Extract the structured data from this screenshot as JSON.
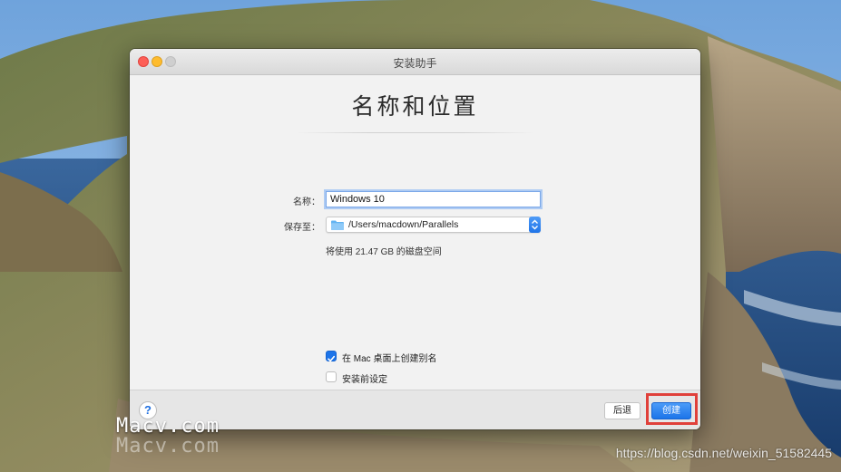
{
  "window": {
    "title": "安装助手"
  },
  "page": {
    "heading": "名称和位置"
  },
  "form": {
    "name_label": "名称：",
    "name_value": "Windows 10",
    "location_label": "保存至：",
    "location_value": "/Users/macdown/Parallels",
    "disk_info": "将使用 21.47 GB 的磁盘空间"
  },
  "options": {
    "create_alias_label": "在 Mac 桌面上创建别名",
    "create_alias_checked": true,
    "configure_label": "安装前设定",
    "configure_checked": false
  },
  "footer": {
    "help_label": "?",
    "back_label": "后退",
    "create_label": "创建"
  },
  "watermark": {
    "site": "Macv.com",
    "url": "https://blog.csdn.net/weixin_51582445"
  },
  "icons": {
    "folder": "folder-icon",
    "checkmark": "checkmark-icon",
    "stepper": "chevron-updown-icon"
  },
  "colors": {
    "accent": "#1c74e9",
    "highlight_frame": "#e0403a",
    "close": "#fd5f57",
    "minimize": "#febc2e"
  }
}
